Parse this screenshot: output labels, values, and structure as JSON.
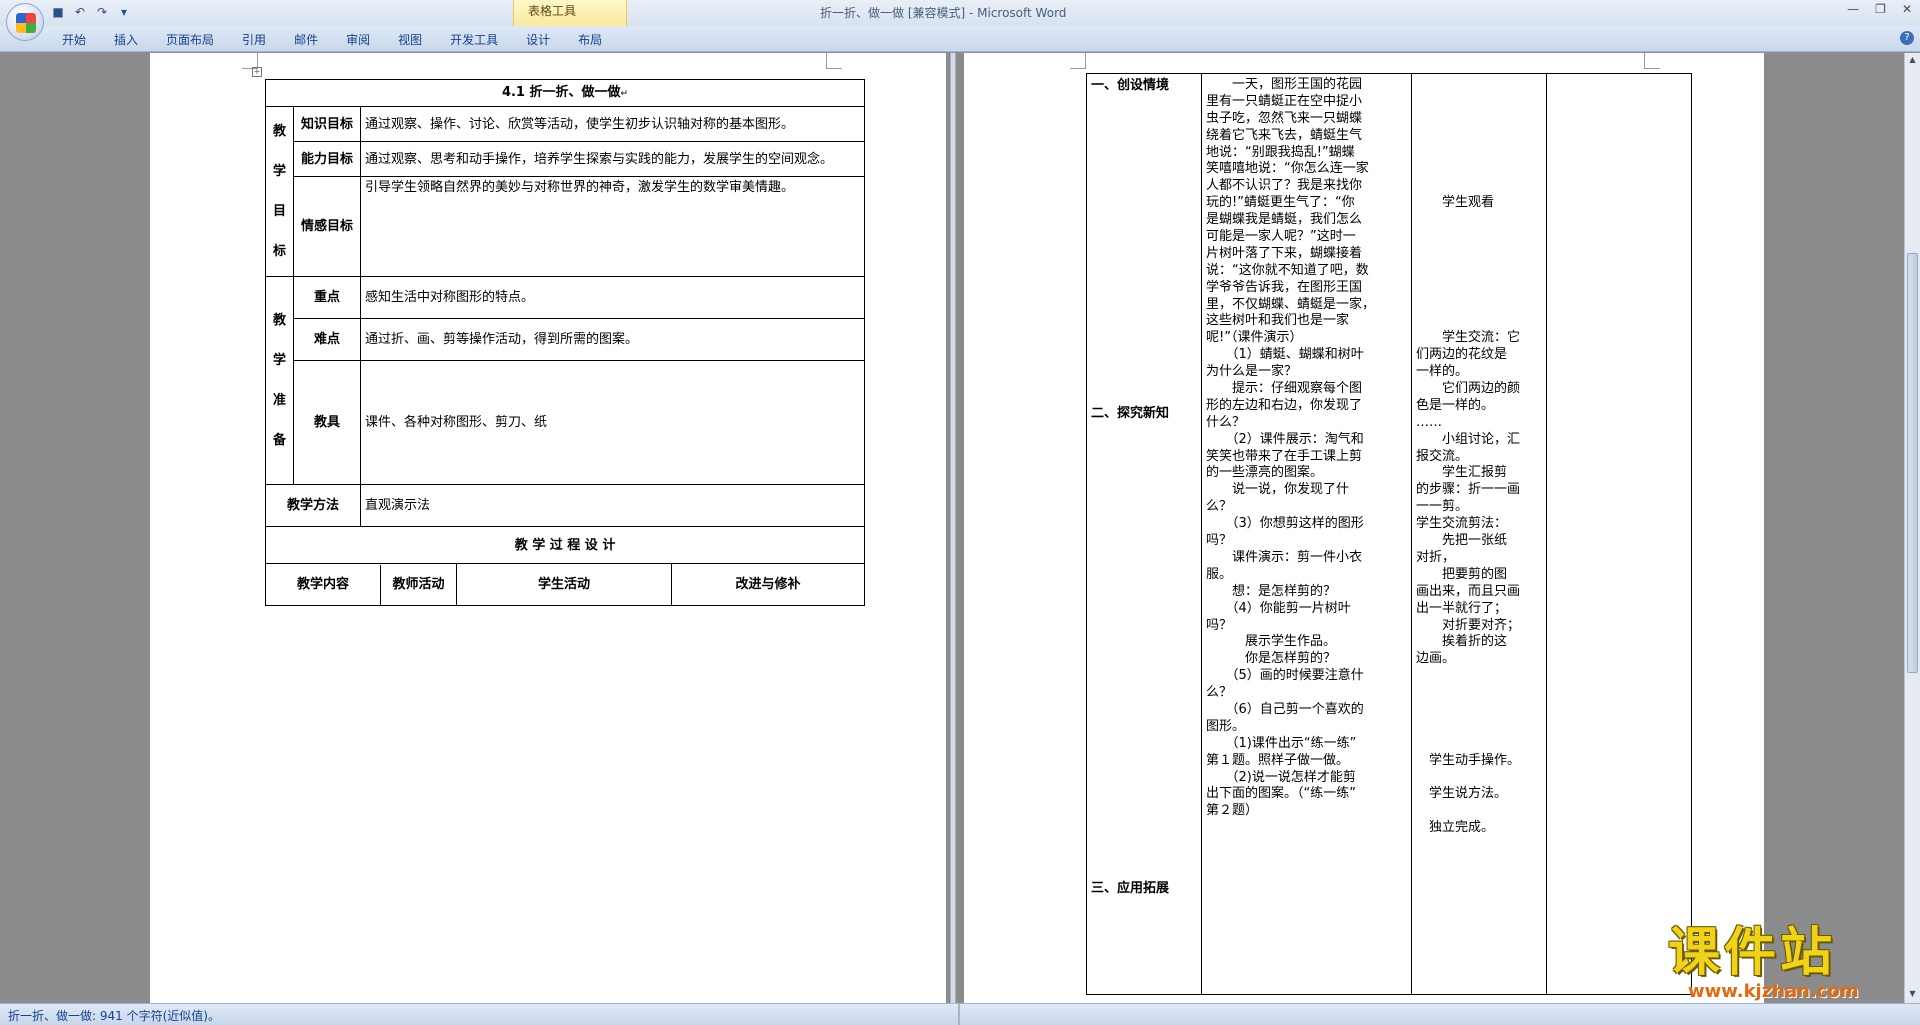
{
  "app": {
    "title": "折一折、做一做 [兼容模式] - Microsoft Word",
    "context_tab": "表格工具",
    "tabs": [
      "开始",
      "插入",
      "页面布局",
      "引用",
      "邮件",
      "审阅",
      "视图",
      "开发工具",
      "设计",
      "布局"
    ]
  },
  "status": {
    "text": "折一折、做一做: 941 个字符(近似值)。"
  },
  "page1": {
    "title": "4.1 折一折、做一做",
    "goals_label": [
      "教",
      "学",
      "目",
      "标"
    ],
    "knowledge_label": "知识目标",
    "knowledge_text": "通过观察、操作、讨论、欣赏等活动，使学生初步认识轴对称的基本图形。",
    "ability_label": "能力目标",
    "ability_text": "通过观察、思考和动手操作，培养学生探索与实践的能力，发展学生的空间观念。",
    "emotion_label": "情感目标",
    "emotion_text": "引导学生领略自然界的美妙与对称世界的神奇，激发学生的数学审美情趣。",
    "prep_label": [
      "教",
      "学",
      "准",
      "备"
    ],
    "key_label": "重点",
    "key_text": "感知生活中对称图形的特点。",
    "difficulty_label": "难点",
    "difficulty_text": "通过折、画、剪等操作活动，得到所需的图案。",
    "tools_label": "教具",
    "tools_text": "课件、各种对称图形、剪刀、纸",
    "method_label": "教学方法",
    "method_text": "直观演示法",
    "process_title": "教 学 过 程 设 计",
    "headers": [
      "教学内容",
      "教师活动",
      "学生活动",
      "改进与修补"
    ]
  },
  "page2": {
    "sections": [
      "一、创设情境",
      "二、探究新知",
      "三、应用拓展"
    ],
    "teacher_lines": [
      "　　一天，图形王国的花园",
      "里有一只蜻蜓正在空中捉小",
      "虫子吃，忽然飞来一只蝴蝶",
      "绕着它飞来飞去，蜻蜓生气",
      "地说：“别跟我捣乱!”蝴蝶",
      "笑嘻嘻地说：“你怎么连一家",
      "人都不认识了？我是来找你",
      "玩的!”蜻蜓更生气了：“你",
      "是蝴蝶我是蜻蜓，我们怎么",
      "可能是一家人呢？”这时一",
      "片树叶落了下来，蝴蝶接着",
      "说：“这你就不知道了吧，数",
      "学爷爷告诉我，在图形王国",
      "里，不仅蝴蝶、蜻蜓是一家，",
      "这些树叶和我们也是一家",
      "呢!”（课件演示）",
      "　　（1）蜻蜓、蝴蝶和树叶",
      "为什么是一家？",
      "　　提示：仔细观察每个图",
      "形的左边和右边，你发现了",
      "什么？",
      "　　（2）课件展示：淘气和",
      "笑笑也带来了在手工课上剪",
      "的一些漂亮的图案。",
      "　　说一说，你发现了什",
      "么？",
      "　　（3）你想剪这样的图形",
      "吗？",
      "　　课件演示：剪一件小衣",
      "服。",
      "　　想：是怎样剪的？",
      "　　（4）你能剪一片树叶",
      "吗？",
      "　　　展示学生作品。",
      "　　　你是怎样剪的？",
      "　　（5）画的时候要注意什",
      "么？",
      "　　（6）自己剪一个喜欢的",
      "图形。",
      "　　（1)课件出示“练一练”",
      "第１题。照样子做一做。",
      "　　（2)说一说怎样才能剪",
      "出下面的图案。（“练一练”",
      "第２题）"
    ],
    "student_lines": [
      "",
      "",
      "",
      "",
      "",
      "",
      "",
      "　　学生观看",
      "",
      "",
      "",
      "",
      "",
      "",
      "",
      "　　学生交流：它",
      "们两边的花纹是",
      "一样的。",
      "　　它们两边的颜",
      "色是一样的。",
      "……",
      "　　小组讨论，汇",
      "报交流。",
      "　　学生汇报剪",
      "的步骤：折一一画",
      "一一剪。",
      "学生交流剪法：",
      "　　先把一张纸",
      "对折，",
      "　　把要剪的图",
      "画出来，而且只画",
      "出一半就行了；",
      "　　对折要对齐；",
      "　　挨着折的这",
      "边画。",
      "",
      "",
      "",
      "",
      "",
      "　学生动手操作。",
      "",
      "　学生说方法。",
      "",
      "　独立完成。"
    ]
  },
  "watermark": {
    "main": "课件站",
    "url": "www.kjzhan.com"
  }
}
